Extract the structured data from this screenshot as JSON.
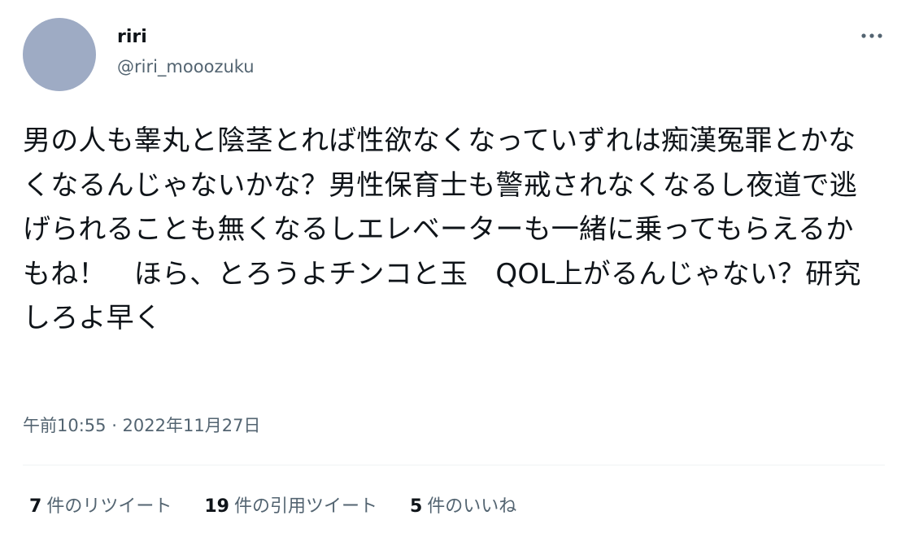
{
  "user": {
    "display_name": "riri",
    "handle": "@riri_mooozuku"
  },
  "more_icon": "more-horizontal-icon",
  "tweet": {
    "text": "男の人も睾丸と陰茎とれば性欲なくなっていずれは痴漢冤罪とかなくなるんじゃないかな？男性保育士も警戒されなくなるし夜道で逃げられることも無くなるしエレベーターも一緒に乗ってもらえるかもね！　ほら、とろうよチンコと玉　QOL上がるんじゃない？研究しろよ早く",
    "timestamp": "午前10:55 · 2022年11月27日"
  },
  "stats": {
    "retweets": {
      "count": "7",
      "label": "件のリツイート"
    },
    "quotes": {
      "count": "19",
      "label": "件の引用ツイート"
    },
    "likes": {
      "count": "5",
      "label": "件のいいね"
    }
  },
  "colors": {
    "avatar": "#9eabc4",
    "text_primary": "#0f1419",
    "text_secondary": "#536471",
    "divider": "#eff3f4"
  }
}
